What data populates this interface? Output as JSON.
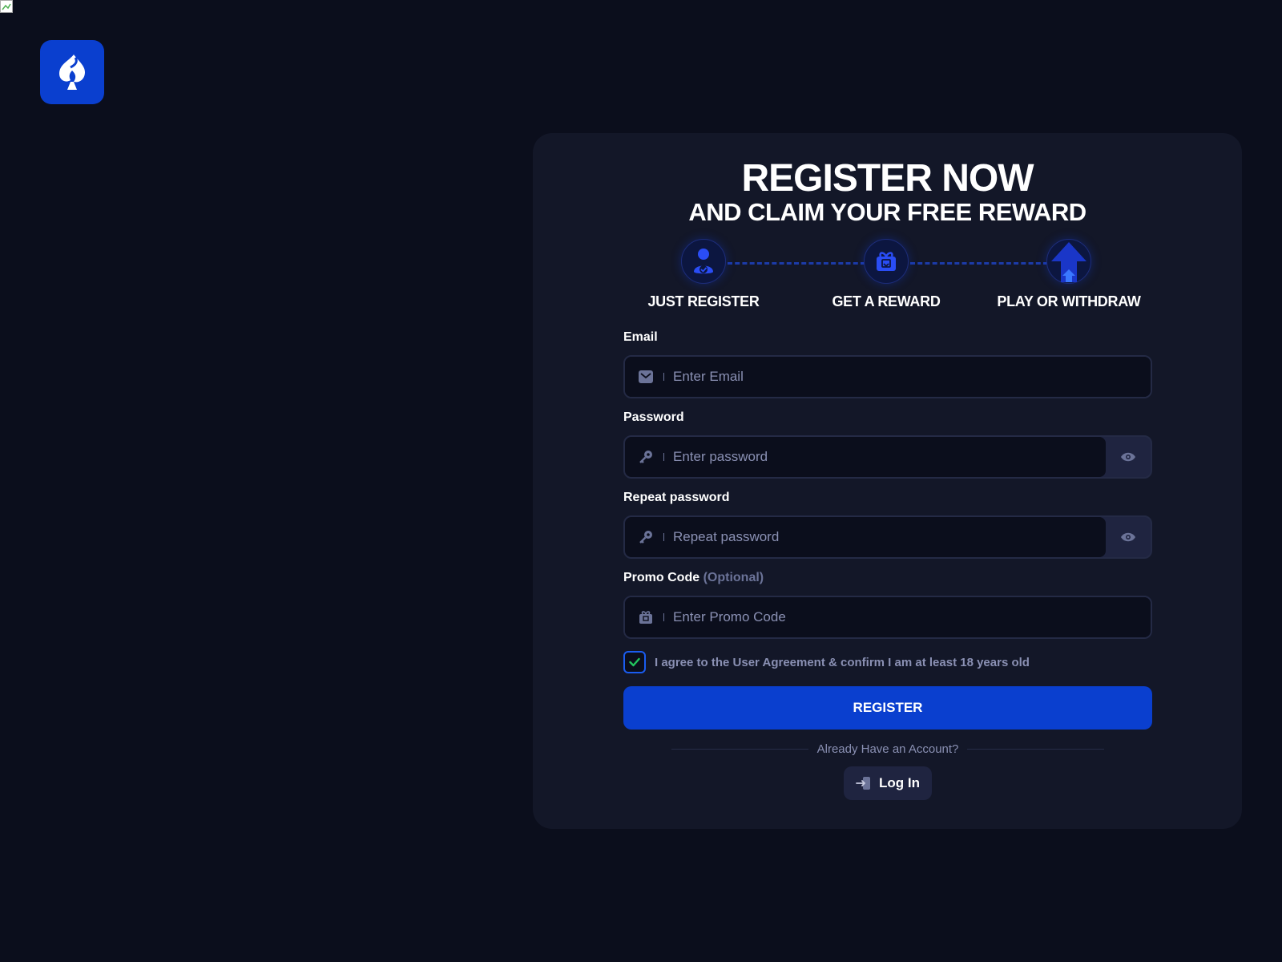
{
  "header": {
    "logo_icon": "spade-logo-icon",
    "brand_color": "#0a3fcf"
  },
  "card": {
    "title": "REGISTER NOW",
    "subtitle": "AND CLAIM YOUR FREE REWARD"
  },
  "steps": [
    {
      "label": "JUST REGISTER",
      "icon": "user-check-icon"
    },
    {
      "label": "GET A REWARD",
      "icon": "gift-icon"
    },
    {
      "label": "PLAY OR WITHDRAW",
      "icon": "arrow-up-icon"
    }
  ],
  "form": {
    "email": {
      "label": "Email",
      "placeholder": "Enter Email",
      "value": "",
      "icon": "mail-icon"
    },
    "password": {
      "label": "Password",
      "placeholder": "Enter password",
      "value": "",
      "icon": "key-icon"
    },
    "repeat_password": {
      "label": "Repeat password",
      "placeholder": "Repeat password",
      "value": "",
      "icon": "key-icon"
    },
    "promo": {
      "label": "Promo Code",
      "optional": "(Optional)",
      "placeholder": "Enter Promo Code",
      "value": "",
      "icon": "gift-icon"
    },
    "agree": {
      "checked": true,
      "text": "I agree to the User Agreement & confirm I am at least 18 years old"
    },
    "register_label": "REGISTER",
    "already_text": "Already Have an Account?",
    "login_label": "Log In"
  },
  "colors": {
    "background": "#0b0e1c",
    "card": "#131728",
    "accent": "#0a3fcf",
    "check": "#22c55e",
    "muted": "#8a90b3"
  }
}
